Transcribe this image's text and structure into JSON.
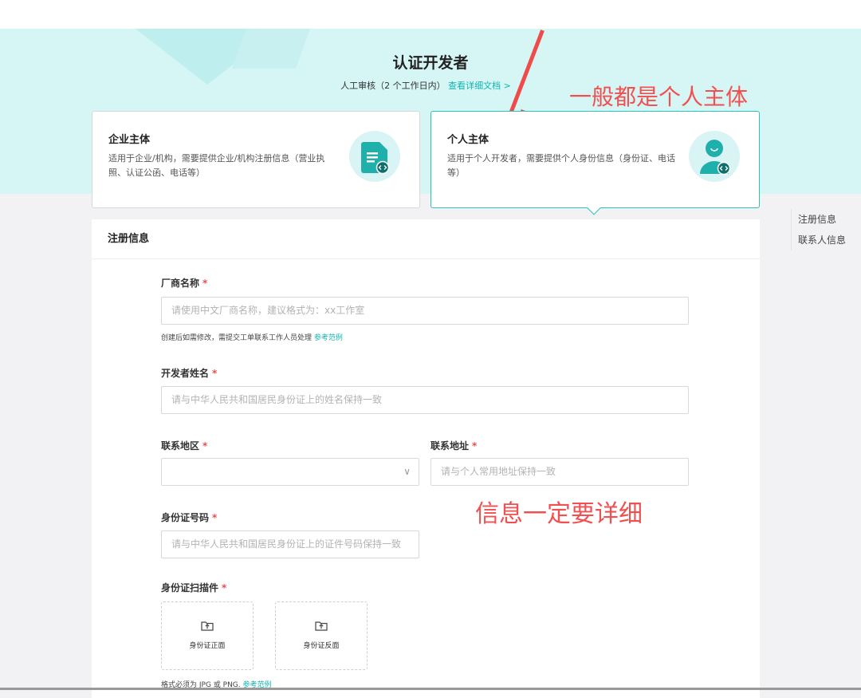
{
  "hero": {
    "title": "认证开发者",
    "subtitle": "人工审核（2 个工作日内）",
    "doc_link": "查看详细文档 >"
  },
  "annotations": {
    "top": "一般都是个人主体",
    "middle": "信息一定要详细"
  },
  "cards": [
    {
      "title": "企业主体",
      "desc": "适用于企业/机构，需要提供企业/机构注册信息（营业执照、认证公函、电话等）",
      "icon": "document-code-icon",
      "selected": false
    },
    {
      "title": "个人主体",
      "desc": "适用于个人开发者，需要提供个人身份信息（身份证、电话等）",
      "icon": "person-code-icon",
      "selected": true
    }
  ],
  "side_nav": [
    "注册信息",
    "联系人信息"
  ],
  "form": {
    "section_title": "注册信息",
    "required_mark": "*",
    "vendor_name": {
      "label": "厂商名称",
      "placeholder": "请使用中文厂商名称，建议格式为：xx工作室",
      "hint": "创建后如需修改，需提交工单联系工作人员处理",
      "hint_link": "参考范例"
    },
    "developer_name": {
      "label": "开发者姓名",
      "placeholder": "请与中华人民共和国居民身份证上的姓名保持一致"
    },
    "region": {
      "label": "联系地区",
      "value": ""
    },
    "address": {
      "label": "联系地址",
      "placeholder": "请与个人常用地址保持一致"
    },
    "id_number": {
      "label": "身份证号码",
      "placeholder": "请与中华人民共和国居民身份证上的证件号码保持一致"
    },
    "id_scan": {
      "label": "身份证扫描件",
      "front": "身份证正面",
      "back": "身份证反面",
      "hint": "格式必须为 JPG 或 PNG.",
      "hint_link": "参考范例"
    }
  },
  "colors": {
    "accent": "#12b5b0",
    "required": "#f04b4b",
    "hero_bg": "#d6f5f5"
  }
}
